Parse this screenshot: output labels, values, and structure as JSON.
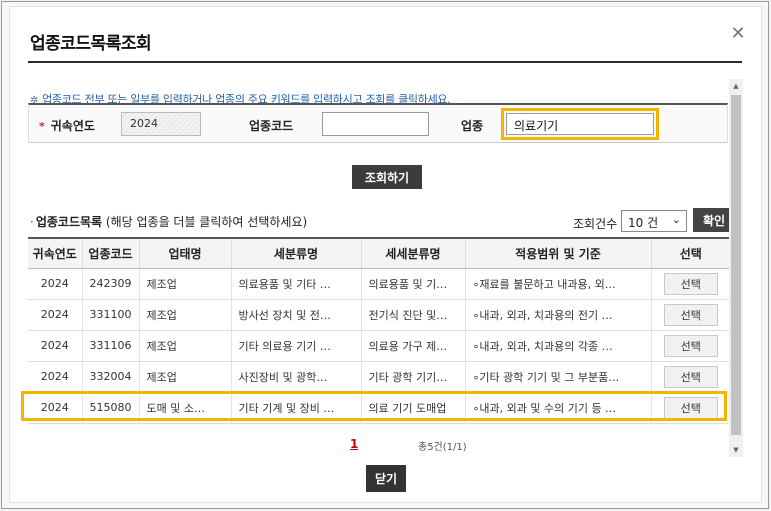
{
  "dialog": {
    "title": "업종코드목록조회",
    "close_icon": "close-icon",
    "close_glyph": "✕"
  },
  "search": {
    "notice": "업종코드 전부 또는 일부를 입력하거나 업종의 주요 키워드를 입력하시고 조회를 클릭하세요.",
    "notice_icon_glyph": "✲",
    "required_mark": "*",
    "year_label": "귀속연도",
    "year_value": "2024",
    "code_label": "업종코드",
    "code_value": "",
    "industry_label": "업종",
    "industry_value": "의료기기",
    "search_button": "조회하기",
    "highlight_color": "#f4b400"
  },
  "list": {
    "bullet": "·",
    "title": "업종코드목록",
    "hint": "(해당 업종을 더블 클릭하여 선택하세요)",
    "count_label": "조회건수",
    "count_value": "10 건",
    "confirm_button": "확인",
    "columns": [
      "귀속연도",
      "업종코드",
      "업태명",
      "세분류명",
      "세세분류명",
      "적용범위 및 기준",
      "선택"
    ],
    "rows": [
      {
        "year": "2024",
        "code": "242309",
        "type": "제조업",
        "sub": "의료용품 및 기타 …",
        "subsub": "의료용품 및 기…",
        "scope": "∘재료를 불문하고 내과용, 외…",
        "select": "선택"
      },
      {
        "year": "2024",
        "code": "331100",
        "type": "제조업",
        "sub": "방사선 장치 및 전…",
        "subsub": "전기식 진단 및…",
        "scope": "∘내과, 외과, 치과용의 전기 …",
        "select": "선택"
      },
      {
        "year": "2024",
        "code": "331106",
        "type": "제조업",
        "sub": "기타 의료용 기기 …",
        "subsub": "의료용 가구 제…",
        "scope": "∘내과, 외과, 치과용의 각종 …",
        "select": "선택"
      },
      {
        "year": "2024",
        "code": "332004",
        "type": "제조업",
        "sub": "사진장비 및 광학…",
        "subsub": "기타 광학 기기…",
        "scope": "∘기타 광학 기기 및 그 부분품…",
        "select": "선택"
      },
      {
        "year": "2024",
        "code": "515080",
        "type": "도매 및 소…",
        "sub": "기타 기계 및 장비 …",
        "subsub": "의료 기기 도매업",
        "scope": "∘내과, 외과 및 수의 기기 등 …",
        "select": "선택"
      }
    ],
    "page": "1",
    "total": "총5건(1/1)"
  },
  "footer": {
    "close_button": "닫기"
  }
}
